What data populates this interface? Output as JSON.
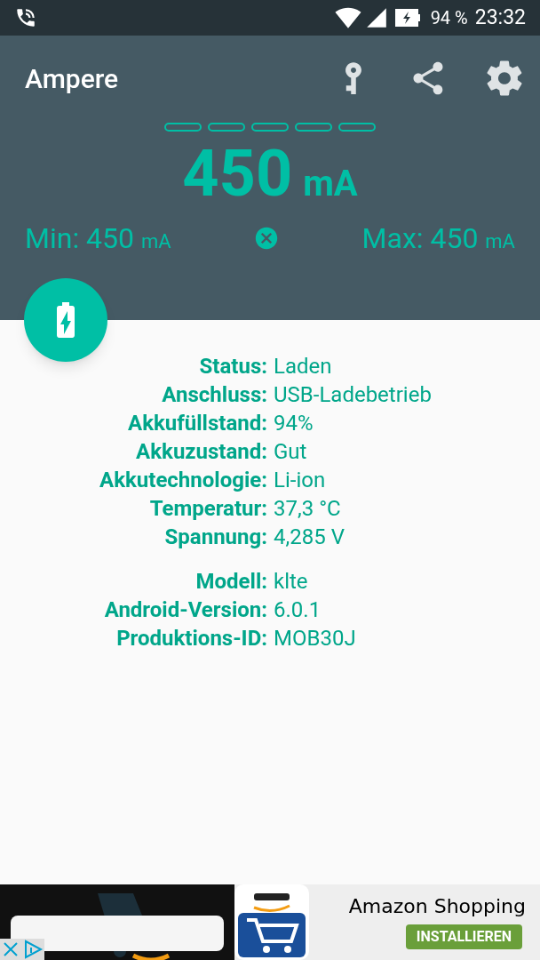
{
  "status_bar": {
    "battery": "94 %",
    "time": "23:32"
  },
  "app_bar": {
    "title": "Ampere"
  },
  "meter": {
    "segments": [
      {
        "filled": false
      },
      {
        "filled": false
      },
      {
        "filled": false
      },
      {
        "filled": false
      },
      {
        "filled": false
      }
    ],
    "value": "450",
    "unit": "mA",
    "min_label": "Min:",
    "min_value": "450",
    "min_unit": "mA",
    "max_label": "Max:",
    "max_value": "450",
    "max_unit": "mA"
  },
  "info_groups": [
    [
      {
        "label": "Status:",
        "value": "Laden"
      },
      {
        "label": "Anschluss:",
        "value": "USB-Ladebetrieb"
      },
      {
        "label": "Akkufüllstand:",
        "value": "94%"
      },
      {
        "label": "Akkuzustand:",
        "value": "Gut"
      },
      {
        "label": "Akkutechnologie:",
        "value": "Li-ion"
      },
      {
        "label": "Temperatur:",
        "value": "37,3 °C"
      },
      {
        "label": "Spannung:",
        "value": "4,285 V"
      }
    ],
    [
      {
        "label": "Modell:",
        "value": "klte"
      },
      {
        "label": "Android-Version:",
        "value": "6.0.1"
      },
      {
        "label": "Produktions-ID:",
        "value": "MOB30J"
      }
    ]
  ],
  "ad": {
    "title": "Amazon Shopping",
    "button": "INSTALLIEREN"
  }
}
